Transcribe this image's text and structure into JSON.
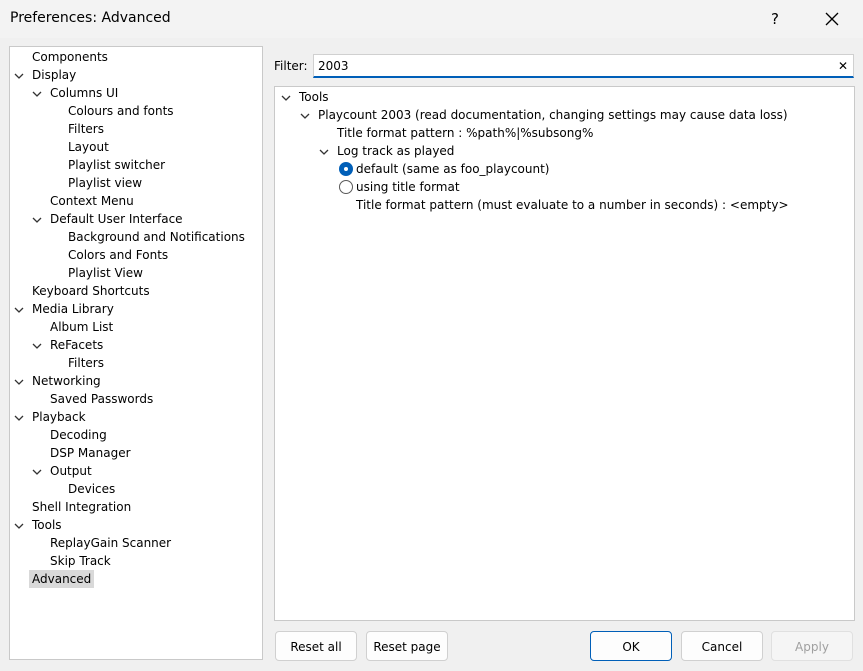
{
  "window": {
    "title": "Preferences: Advanced",
    "help_label": "?"
  },
  "tree": [
    {
      "label": "Components",
      "level": 0,
      "expanded": null,
      "selected": false
    },
    {
      "label": "Display",
      "level": 0,
      "expanded": true,
      "selected": false
    },
    {
      "label": "Columns UI",
      "level": 1,
      "expanded": true,
      "selected": false
    },
    {
      "label": "Colours and fonts",
      "level": 2,
      "expanded": null,
      "selected": false
    },
    {
      "label": "Filters",
      "level": 2,
      "expanded": null,
      "selected": false
    },
    {
      "label": "Layout",
      "level": 2,
      "expanded": null,
      "selected": false
    },
    {
      "label": "Playlist switcher",
      "level": 2,
      "expanded": null,
      "selected": false
    },
    {
      "label": "Playlist view",
      "level": 2,
      "expanded": null,
      "selected": false
    },
    {
      "label": "Context Menu",
      "level": 1,
      "expanded": null,
      "selected": false
    },
    {
      "label": "Default User Interface",
      "level": 1,
      "expanded": true,
      "selected": false
    },
    {
      "label": "Background and Notifications",
      "level": 2,
      "expanded": null,
      "selected": false
    },
    {
      "label": "Colors and Fonts",
      "level": 2,
      "expanded": null,
      "selected": false
    },
    {
      "label": "Playlist View",
      "level": 2,
      "expanded": null,
      "selected": false
    },
    {
      "label": "Keyboard Shortcuts",
      "level": 0,
      "expanded": null,
      "selected": false
    },
    {
      "label": "Media Library",
      "level": 0,
      "expanded": true,
      "selected": false
    },
    {
      "label": "Album List",
      "level": 1,
      "expanded": null,
      "selected": false
    },
    {
      "label": "ReFacets",
      "level": 1,
      "expanded": true,
      "selected": false
    },
    {
      "label": "Filters",
      "level": 2,
      "expanded": null,
      "selected": false
    },
    {
      "label": "Networking",
      "level": 0,
      "expanded": true,
      "selected": false
    },
    {
      "label": "Saved Passwords",
      "level": 1,
      "expanded": null,
      "selected": false
    },
    {
      "label": "Playback",
      "level": 0,
      "expanded": true,
      "selected": false
    },
    {
      "label": "Decoding",
      "level": 1,
      "expanded": null,
      "selected": false
    },
    {
      "label": "DSP Manager",
      "level": 1,
      "expanded": null,
      "selected": false
    },
    {
      "label": "Output",
      "level": 1,
      "expanded": true,
      "selected": false
    },
    {
      "label": "Devices",
      "level": 2,
      "expanded": null,
      "selected": false
    },
    {
      "label": "Shell Integration",
      "level": 0,
      "expanded": null,
      "selected": false
    },
    {
      "label": "Tools",
      "level": 0,
      "expanded": true,
      "selected": false
    },
    {
      "label": "ReplayGain Scanner",
      "level": 1,
      "expanded": null,
      "selected": false
    },
    {
      "label": "Skip Track",
      "level": 1,
      "expanded": null,
      "selected": false
    },
    {
      "label": "Advanced",
      "level": 0,
      "expanded": null,
      "selected": true
    }
  ],
  "filter": {
    "label": "Filter:",
    "value": "2003",
    "clear_label": "✕"
  },
  "settings": [
    {
      "type": "node",
      "label": "Tools",
      "level": 0,
      "expanded": true
    },
    {
      "type": "node",
      "label": "Playcount 2003 (read documentation, changing settings may cause data loss)",
      "level": 1,
      "expanded": true
    },
    {
      "type": "text",
      "label": "Title format pattern : %path%|%subsong%",
      "level": 2
    },
    {
      "type": "node",
      "label": "Log track as played",
      "level": 2,
      "expanded": true
    },
    {
      "type": "radio",
      "label": "default (same as foo_playcount)",
      "level": 3,
      "checked": true
    },
    {
      "type": "radio",
      "label": "using title format",
      "level": 3,
      "checked": false
    },
    {
      "type": "text",
      "label": "Title format pattern (must evaluate to a number in seconds) : <empty>",
      "level": 3
    }
  ],
  "buttons": {
    "reset_all": "Reset all",
    "reset_page": "Reset page",
    "ok": "OK",
    "cancel": "Cancel",
    "apply": "Apply"
  },
  "colors": {
    "accent": "#005fb8",
    "selection": "#d9d9d9"
  }
}
